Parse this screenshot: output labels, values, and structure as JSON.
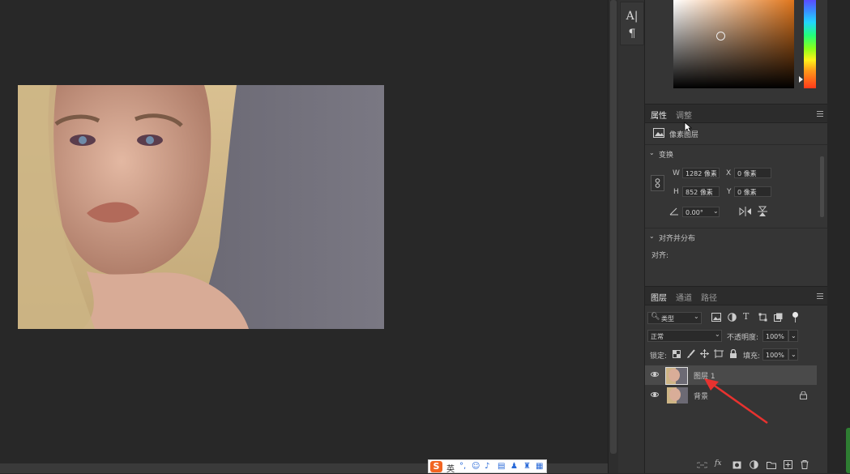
{
  "tools": {
    "text_tool": "A|",
    "paragraph_tool": "¶"
  },
  "properties_panel": {
    "tabs": [
      "属性",
      "调整"
    ],
    "layer_type": "像素图层",
    "transform_title": "变换",
    "w_label": "W",
    "w_value": "1282 像素",
    "x_label": "X",
    "x_value": "0 像素",
    "h_label": "H",
    "h_value": "852 像素",
    "y_label": "Y",
    "y_value": "0 像素",
    "angle_value": "0.00°",
    "align_title": "对齐并分布",
    "align_label": "对齐:"
  },
  "layers_panel": {
    "tabs": [
      "图层",
      "通道",
      "路径"
    ],
    "filter_kind": "类型",
    "blend_mode": "正常",
    "opacity_label": "不透明度:",
    "opacity_value": "100%",
    "lock_label": "锁定:",
    "fill_label": "填充:",
    "fill_value": "100%",
    "layers": [
      {
        "name": "图层 1",
        "selected": true
      },
      {
        "name": "背景",
        "locked": true
      }
    ],
    "footer_fx": "fx"
  },
  "ime": {
    "logo": "S",
    "lang": "英"
  },
  "colors": {
    "accent_arrow": "#e8322f",
    "panel_bg": "#353535",
    "canvas_bg": "#282828"
  }
}
